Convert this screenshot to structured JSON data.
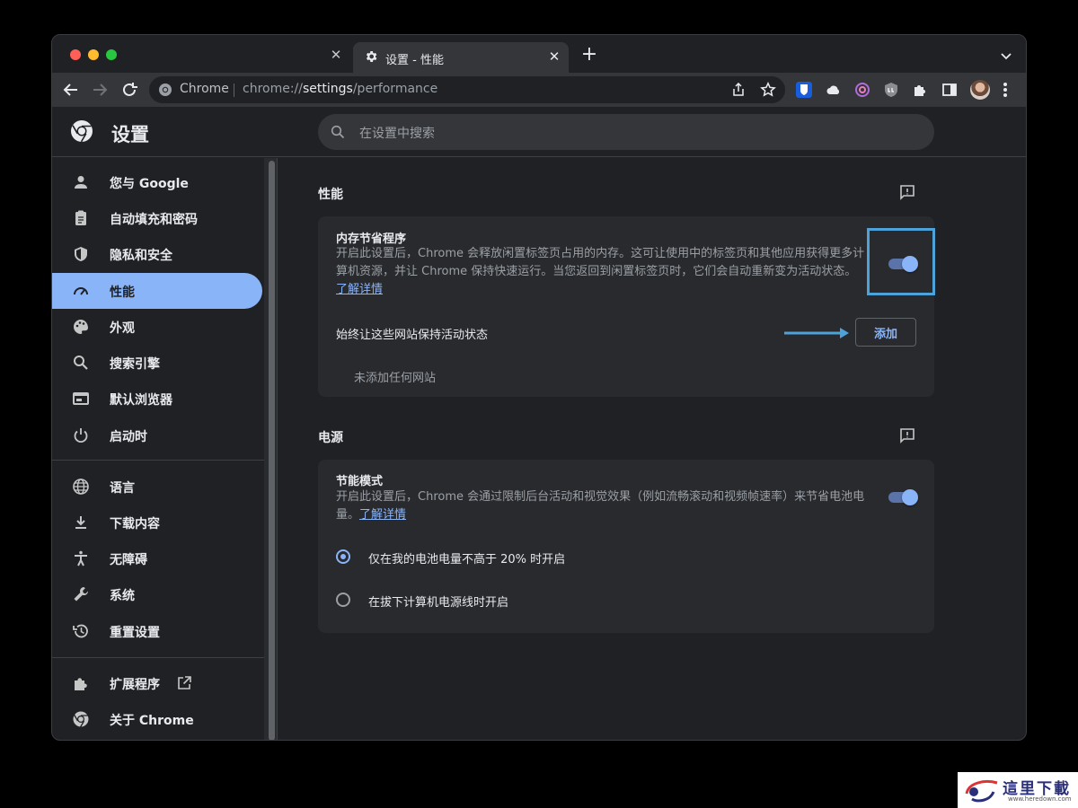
{
  "browser": {
    "active_tab_title": "设置 - 性能",
    "inactive_tab_close": "✕",
    "active_tab_close": "✕",
    "new_tab": "+",
    "site_chip": "Chrome",
    "url_prefix": "chrome://",
    "url_host": "settings",
    "url_path": "/performance"
  },
  "settings": {
    "title": "设置",
    "search_placeholder": "在设置中搜索"
  },
  "sidebar": {
    "items": [
      {
        "label": "您与 Google",
        "icon": "person-icon"
      },
      {
        "label": "自动填充和密码",
        "icon": "clipboard-icon"
      },
      {
        "label": "隐私和安全",
        "icon": "shield-icon"
      },
      {
        "label": "性能",
        "icon": "speedometer-icon",
        "active": true
      },
      {
        "label": "外观",
        "icon": "palette-icon"
      },
      {
        "label": "搜索引擎",
        "icon": "search-icon"
      },
      {
        "label": "默认浏览器",
        "icon": "browser-icon"
      },
      {
        "label": "启动时",
        "icon": "power-icon"
      },
      {
        "label": "语言",
        "icon": "globe-icon"
      },
      {
        "label": "下载内容",
        "icon": "download-icon"
      },
      {
        "label": "无障碍",
        "icon": "accessibility-icon"
      },
      {
        "label": "系统",
        "icon": "wrench-icon"
      },
      {
        "label": "重置设置",
        "icon": "history-icon"
      },
      {
        "label": "扩展程序",
        "icon": "puzzle-icon"
      },
      {
        "label": "关于 Chrome",
        "icon": "chrome-icon"
      }
    ]
  },
  "performance": {
    "section_title": "性能",
    "memory_saver": {
      "title": "内存节省程序",
      "desc_line1": "开启此设置后，Chrome 会释放闲置标签页占用的内存。这可让使用中的标签页和其他应用获得更多计",
      "desc_line2": "算机资源，并让 Chrome 保持快速运行。当您返回到闲置标签页时，它们会自动重新变为活动状态。",
      "learn_more": "了解详情",
      "enabled": true
    },
    "always_active": {
      "title": "始终让这些网站保持活动状态",
      "add_button": "添加",
      "empty": "未添加任何网站"
    }
  },
  "power": {
    "section_title": "电源",
    "energy_saver": {
      "title": "节能模式",
      "desc_line1": "开启此设置后，Chrome 会通过限制后台活动和视觉效果（例如流畅滚动和视频帧速率）来节省电池电",
      "desc_line2": "量。",
      "learn_more": "了解详情",
      "enabled": true
    },
    "options": [
      {
        "label": "仅在我的电池电量不高于 20% 时开启",
        "selected": true
      },
      {
        "label": "在拔下计算机电源线时开启",
        "selected": false
      }
    ]
  },
  "watermark": {
    "text": "這里下載",
    "url": "www.heredown.com"
  },
  "colors": {
    "accent": "#8ab4f8",
    "background": "#202124",
    "card": "#292a2d",
    "highlight": "#4da3d9"
  }
}
